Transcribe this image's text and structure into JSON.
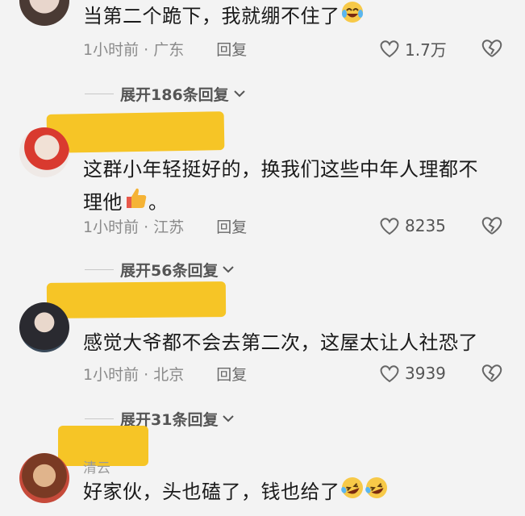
{
  "comments": [
    {
      "text": "当第二个跪下，我就绷不住了",
      "emoji": "crying-laughing-emoji",
      "time_location": "1小时前 · 广东",
      "reply_label": "回复",
      "likes": "1.7万",
      "expand_label": "展开186条回复"
    },
    {
      "text_line1": "这群小年轻挺好的，换我们这些中年人理都不",
      "text_line2": "理他",
      "text_suffix": "。",
      "emoji": "thumbs-up-emoji",
      "time_location": "1小时前 · 江苏",
      "reply_label": "回复",
      "likes": "8235",
      "expand_label": "展开56条回复"
    },
    {
      "text": "感觉大爷都不会去第二次，这屋太让人社恐了",
      "time_location": "1小时前 · 北京",
      "reply_label": "回复",
      "likes": "3939",
      "expand_label": "展开31条回复"
    },
    {
      "username": "清云",
      "text": "好家伙，头也磕了，钱也给了",
      "emoji": "rolling-laughing-emoji"
    }
  ],
  "colors": {
    "redaction": "#f6c21a",
    "meta_text": "#8a8a8a",
    "body_text": "#1a1a1a"
  }
}
